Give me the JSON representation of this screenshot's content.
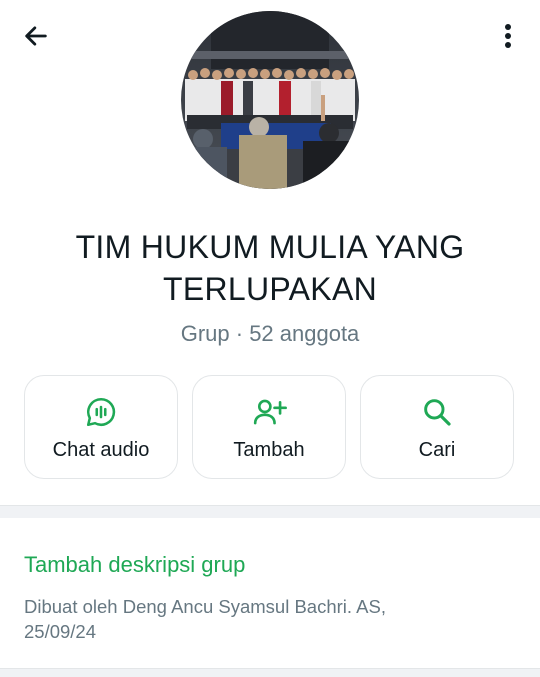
{
  "group": {
    "name_line1": "TIM HUKUM MULIA YANG",
    "name_line2": "TERLUPAKAN",
    "type_label": "Grup",
    "separator": " · ",
    "member_count": "52 anggota"
  },
  "actions": [
    {
      "label": "Chat audio",
      "icon": "audio-chat-icon"
    },
    {
      "label": "Tambah",
      "icon": "add-person-icon"
    },
    {
      "label": "Cari",
      "icon": "search-icon"
    }
  ],
  "description": {
    "add_label": "Tambah deskripsi grup",
    "created_line1": "Dibuat oleh Deng Ancu Syamsul Bachri. AS,",
    "created_line2": "25/09/24"
  },
  "colors": {
    "accent": "#1fa855",
    "secondary_text": "#667781",
    "primary_text": "#111b21"
  }
}
